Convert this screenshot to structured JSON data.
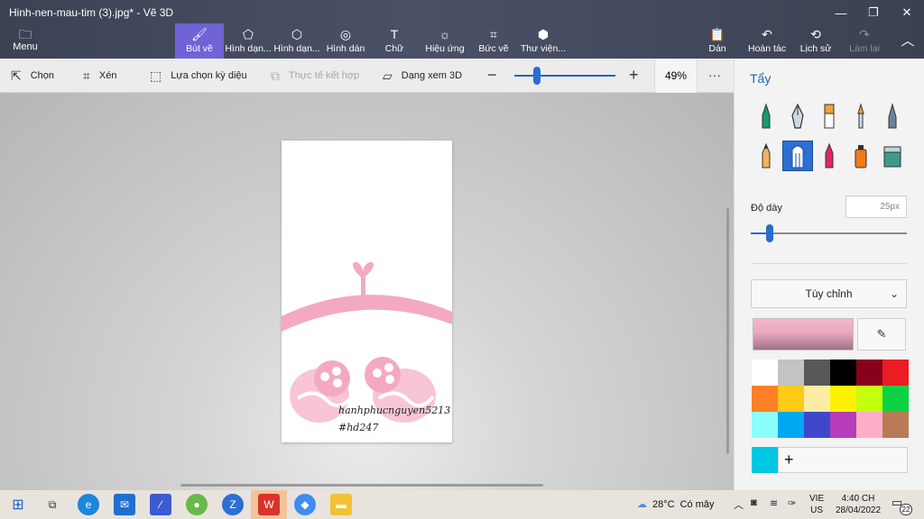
{
  "window": {
    "title": "Hinh-nen-mau-tim (3).jpg* - Vẽ 3D",
    "minimize": "—",
    "maximize": "❐",
    "close": "✕"
  },
  "ribbon": {
    "menu_label": "Menu",
    "tools": [
      {
        "label": "Bút vẽ",
        "icon": "brush-icon"
      },
      {
        "label": "Hình dạn...",
        "icon": "2d-shapes-icon"
      },
      {
        "label": "Hình dạn...",
        "icon": "3d-shapes-icon"
      },
      {
        "label": "Hình dán",
        "icon": "stickers-icon"
      },
      {
        "label": "Chữ",
        "icon": "text-icon"
      },
      {
        "label": "Hiệu ứng",
        "icon": "effects-icon"
      },
      {
        "label": "Bức vẽ",
        "icon": "canvas-icon"
      },
      {
        "label": "Thư viện...",
        "icon": "3d-library-icon"
      }
    ],
    "right_tools": [
      {
        "label": "Dán",
        "icon": "paste-icon"
      },
      {
        "label": "Hoàn tác",
        "icon": "undo-icon"
      },
      {
        "label": "Lịch sử",
        "icon": "history-icon"
      },
      {
        "label": "Làm lại",
        "icon": "redo-icon"
      }
    ]
  },
  "toolbar": {
    "select": "Chọn",
    "crop": "Xén",
    "magic_select": "Lựa chọn kỳ diệu",
    "mixed_reality": "Thực tế kết hợp",
    "view_3d": "Dạng xem 3D",
    "zoom_value": "49%",
    "zoom_fraction": 0.22,
    "more": "···"
  },
  "canvas": {
    "watermark_line1": "hanhphucnguyen5213",
    "watermark_line2": "#hd247"
  },
  "panel": {
    "title": "Tẩy",
    "brushes": [
      "marker-icon",
      "calligraphy-pen-icon",
      "oil-brush-icon",
      "watercolor-icon",
      "pixel-pen-icon",
      "pencil-icon",
      "eraser-icon",
      "crayon-icon",
      "spray-can-icon",
      "fill-icon"
    ],
    "selected_brush": 6,
    "thickness_label": "Độ dày",
    "thickness_value": "25px",
    "thickness_fraction": 0.12,
    "finish_label": "Tùy chỉnh",
    "current_color": "#f2aec6",
    "palette": [
      "#ffffff",
      "#c3c3c3",
      "#585858",
      "#000000",
      "#88001b",
      "#ec1c24",
      "#ff7f27",
      "#ffca18",
      "#fdeca6",
      "#fff200",
      "#c4ff0e",
      "#0ed145",
      "#8cfffb",
      "#00a8f3",
      "#3f48cc",
      "#b83dba",
      "#ffaec8",
      "#b97a56"
    ],
    "custom_color": "#00c7e2",
    "add_label": "+"
  },
  "taskbar": {
    "weather_temp": "28°C",
    "weather_text": "Có mây",
    "lang_line1": "VIE",
    "lang_line2": "US",
    "time": "4:40 CH",
    "date": "28/04/2022",
    "notification_count": "22",
    "apps": [
      "windows-start-icon",
      "task-view-icon",
      "edge-icon",
      "mail-icon",
      "editor-icon",
      "antivirus-icon",
      "zalo-icon",
      "office-icon",
      "paint3d-icon",
      "file-explorer-icon"
    ]
  }
}
